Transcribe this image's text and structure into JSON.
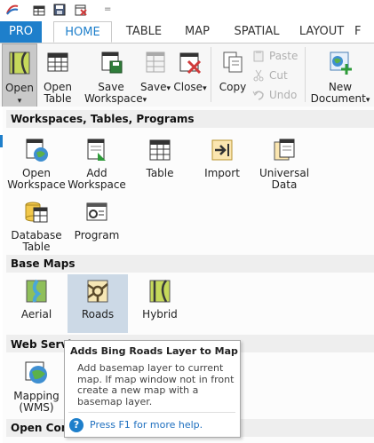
{
  "quick_access": {
    "icons": [
      "app-logo-icon",
      "workspace-icon",
      "save-icon",
      "close-icon",
      "customize-icon"
    ],
    "customize_glyph": "="
  },
  "tabs": [
    {
      "key": "pro",
      "label": "PRO"
    },
    {
      "key": "home",
      "label": "HOME",
      "active": true
    },
    {
      "key": "table",
      "label": "TABLE"
    },
    {
      "key": "map",
      "label": "MAP"
    },
    {
      "key": "spatial",
      "label": "SPATIAL"
    },
    {
      "key": "layout",
      "label": "LAYOUT"
    },
    {
      "key": "more",
      "label": "F"
    }
  ],
  "ribbon": {
    "open": {
      "line1": "Open",
      "arrow": "▾"
    },
    "open_table": {
      "line1": "Open",
      "line2": "Table"
    },
    "save_workspace": {
      "line1": "Save",
      "line2": "Workspace",
      "arrow": "▾"
    },
    "save": {
      "line1": "Save",
      "arrow": "▾"
    },
    "close": {
      "line1": "Close",
      "arrow": "▾"
    },
    "copy": {
      "line1": "Copy"
    },
    "paste": "Paste",
    "cut": "Cut",
    "undo": "Undo",
    "new_document": {
      "line1": "New",
      "line2": "Document",
      "arrow": "▾"
    }
  },
  "panel": {
    "sections": {
      "workspaces": "Workspaces, Tables, Programs",
      "base_maps": "Base Maps",
      "web_services": "Web Servic",
      "open_conn": "Open Conn"
    },
    "workspace_items": [
      {
        "line1": "Open",
        "line2": "Workspace"
      },
      {
        "line1": "Add",
        "line2": "Workspace"
      },
      {
        "line1": "Table",
        "line2": ""
      },
      {
        "line1": "Import",
        "line2": ""
      },
      {
        "line1": "Universal",
        "line2": "Data"
      },
      {
        "line1": "Database",
        "line2": "Table"
      },
      {
        "line1": "Program",
        "line2": ""
      }
    ],
    "basemap_items": [
      {
        "line1": "Aerial"
      },
      {
        "line1": "Roads",
        "selected": true
      },
      {
        "line1": "Hybrid"
      }
    ],
    "web_items": [
      {
        "line1": "Mapping",
        "line2": "(WMS)"
      }
    ]
  },
  "tooltip": {
    "title": "Adds Bing Roads Layer to Map",
    "body": "Add basemap layer to current map. If map window not in front create a new map with a basemap layer.",
    "help_glyph": "?",
    "help": "Press F1 for more help."
  }
}
